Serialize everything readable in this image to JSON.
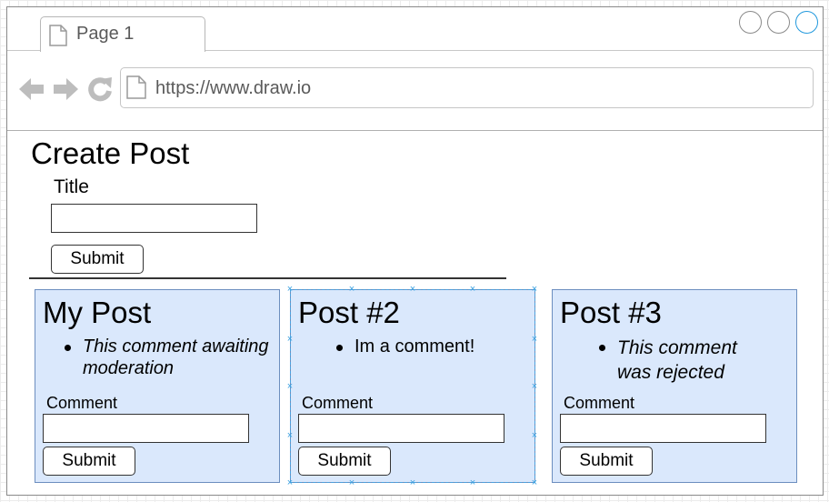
{
  "browser": {
    "tab_label": "Page 1",
    "url": "https://www.draw.io",
    "icons": [
      "page-icon",
      "back-arrow-icon",
      "forward-arrow-icon",
      "refresh-icon",
      "window-control-circle"
    ]
  },
  "create_post": {
    "heading": "Create Post",
    "title_label": "Title",
    "title_value": "",
    "submit_label": "Submit"
  },
  "posts": [
    {
      "title": "My Post",
      "comment": "This comment awaiting moderation",
      "comment_style": "italic",
      "comment_label": "Comment",
      "submit_label": "Submit"
    },
    {
      "title": "Post #2",
      "comment": "Im a comment!",
      "comment_style": "normal",
      "comment_label": "Comment",
      "submit_label": "Submit"
    },
    {
      "title": "Post #3",
      "comment": "This comment was rejected",
      "comment_style": "italic",
      "comment_label": "Comment",
      "submit_label": "Submit"
    }
  ],
  "colors": {
    "card_fill": "#dae8fc",
    "card_border": "#6c8ebf",
    "selection": "#4aa3df",
    "frame_border": "#8a8a8a"
  }
}
